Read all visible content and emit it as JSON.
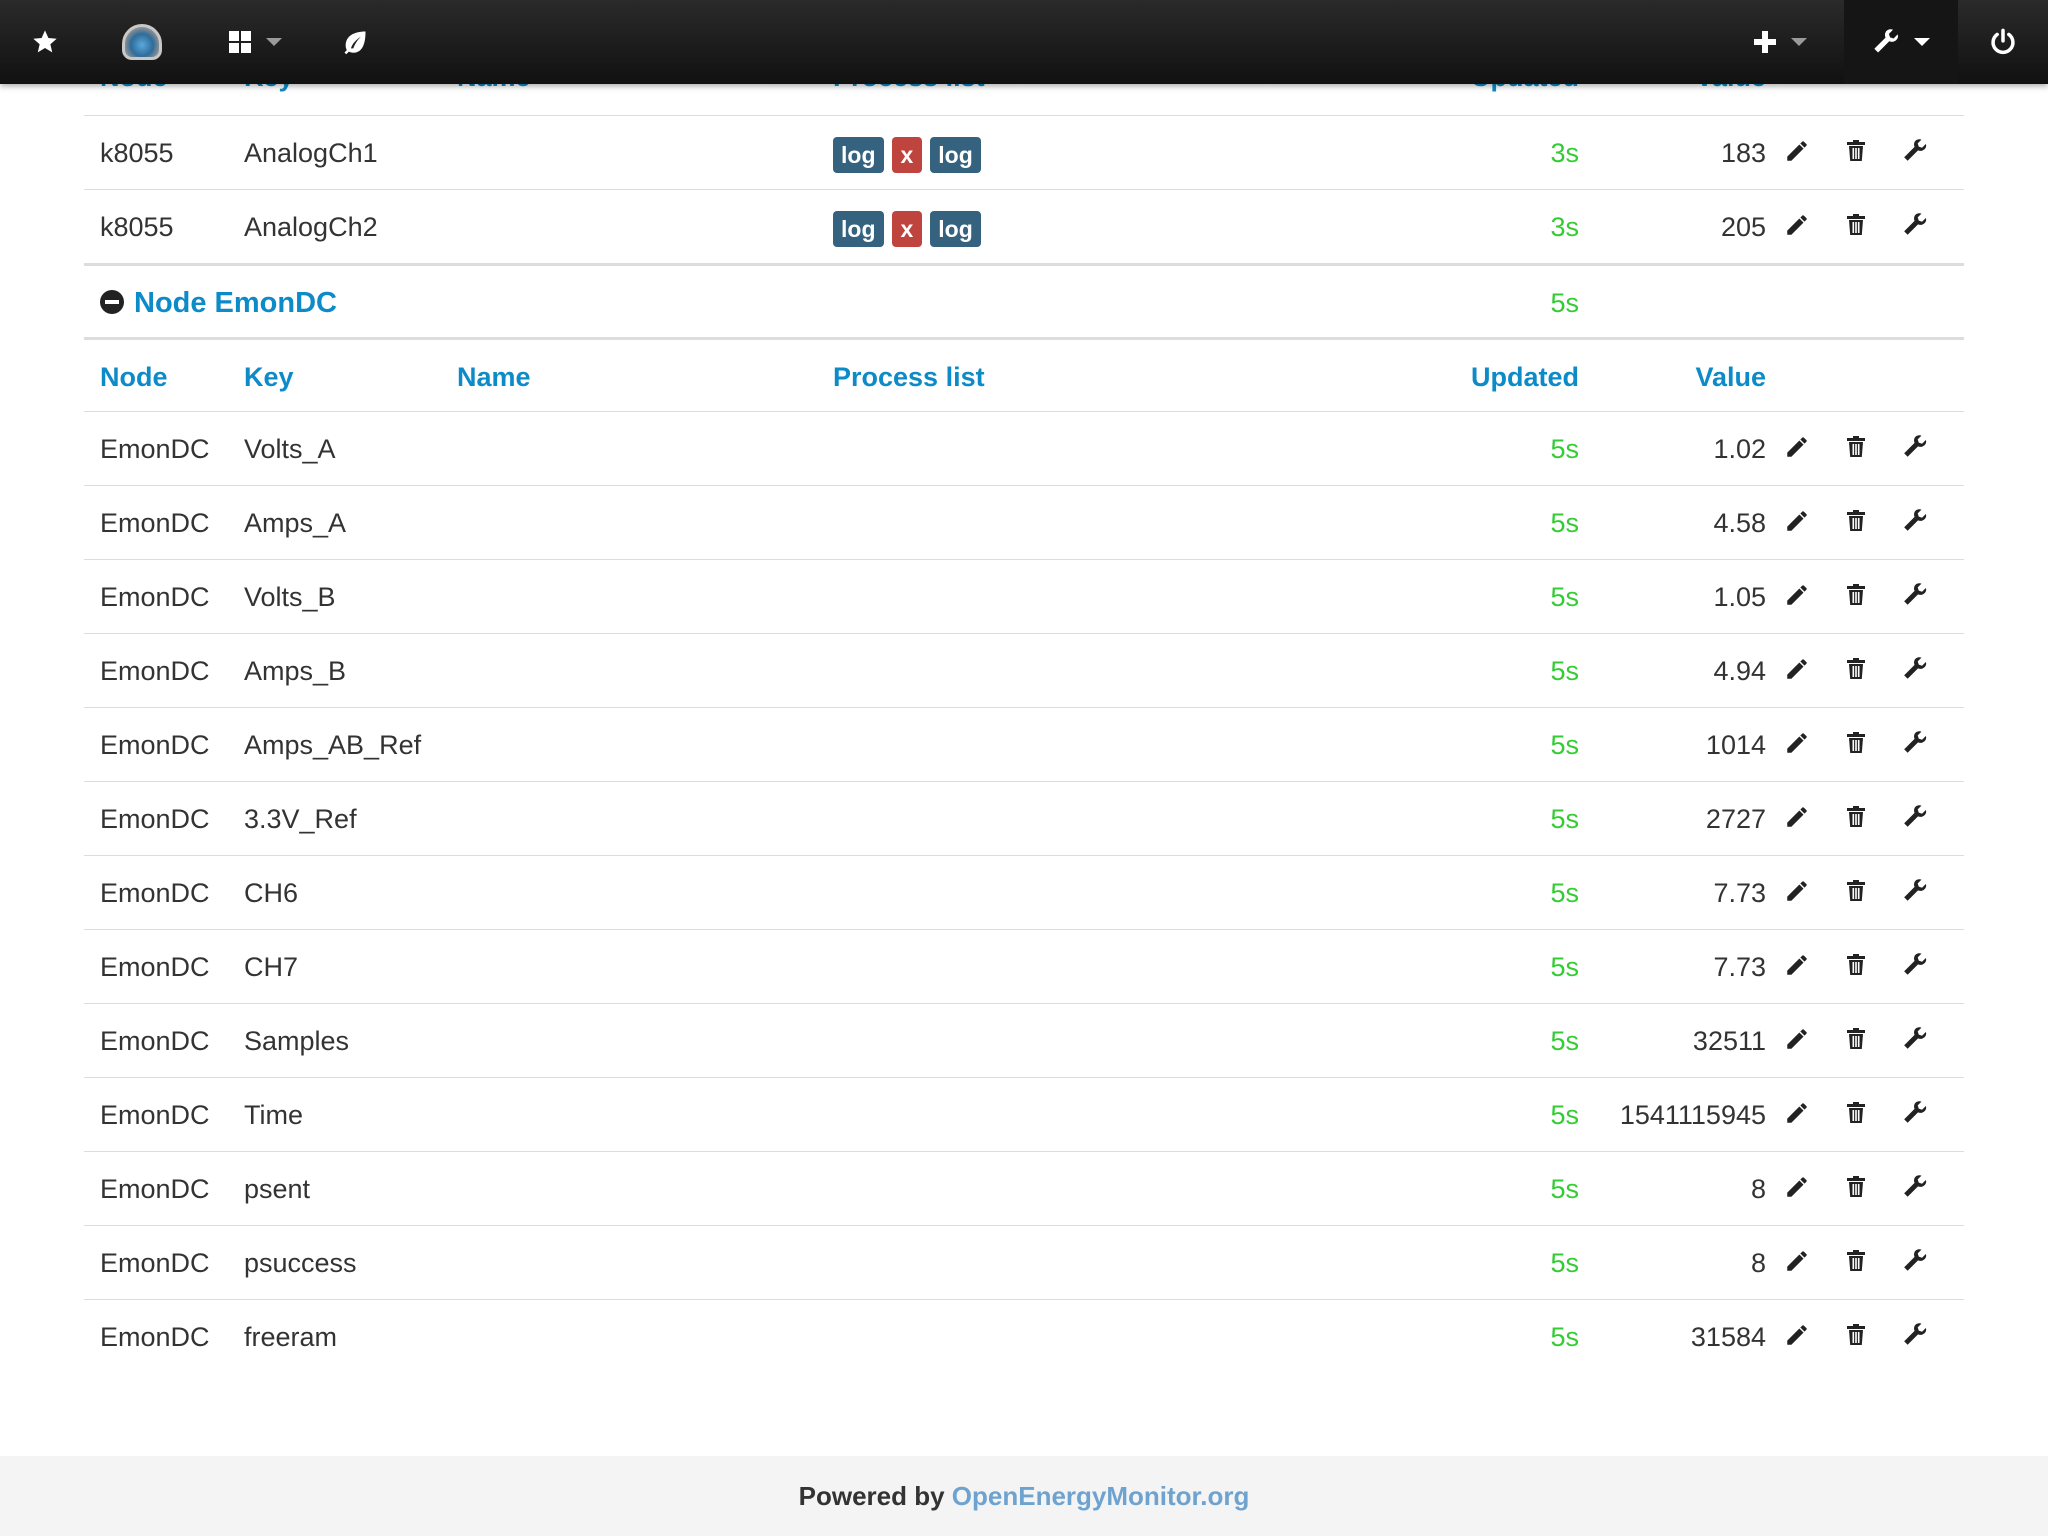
{
  "navbar": {
    "right_menus": [
      "add-menu",
      "setup-menu",
      "logout"
    ]
  },
  "table_header": {
    "node": "Node",
    "key": "Key",
    "name": "Name",
    "process_list": "Process list",
    "updated": "Updated",
    "value": "Value"
  },
  "k8055_rows": [
    {
      "node": "k8055",
      "key": "AnalogCh1",
      "name": "",
      "process": [
        "log",
        "x",
        "log"
      ],
      "updated": "3s",
      "value": "183"
    },
    {
      "node": "k8055",
      "key": "AnalogCh2",
      "name": "",
      "process": [
        "log",
        "x",
        "log"
      ],
      "updated": "3s",
      "value": "205"
    }
  ],
  "group": {
    "title": "Node EmonDC",
    "updated": "5s"
  },
  "emondc_rows": [
    {
      "node": "EmonDC",
      "key": "Volts_A",
      "updated": "5s",
      "value": "1.02"
    },
    {
      "node": "EmonDC",
      "key": "Amps_A",
      "updated": "5s",
      "value": "4.58"
    },
    {
      "node": "EmonDC",
      "key": "Volts_B",
      "updated": "5s",
      "value": "1.05"
    },
    {
      "node": "EmonDC",
      "key": "Amps_B",
      "updated": "5s",
      "value": "4.94"
    },
    {
      "node": "EmonDC",
      "key": "Amps_AB_Ref",
      "updated": "5s",
      "value": "1014"
    },
    {
      "node": "EmonDC",
      "key": "3.3V_Ref",
      "updated": "5s",
      "value": "2727"
    },
    {
      "node": "EmonDC",
      "key": "CH6",
      "updated": "5s",
      "value": "7.73"
    },
    {
      "node": "EmonDC",
      "key": "CH7",
      "updated": "5s",
      "value": "7.73"
    },
    {
      "node": "EmonDC",
      "key": "Samples",
      "updated": "5s",
      "value": "32511"
    },
    {
      "node": "EmonDC",
      "key": "Time",
      "updated": "5s",
      "value": "1541115945"
    },
    {
      "node": "EmonDC",
      "key": "psent",
      "updated": "5s",
      "value": "8"
    },
    {
      "node": "EmonDC",
      "key": "psuccess",
      "updated": "5s",
      "value": "8"
    },
    {
      "node": "EmonDC",
      "key": "freeram",
      "updated": "5s",
      "value": "31584"
    }
  ],
  "footer": {
    "prefix": "Powered by ",
    "link": "OpenEnergyMonitor.org"
  },
  "colors": {
    "updated_recent": "#33cc33",
    "header_link": "#0d8bc8",
    "badge_log": "#34627f",
    "badge_x": "#c0443e"
  }
}
